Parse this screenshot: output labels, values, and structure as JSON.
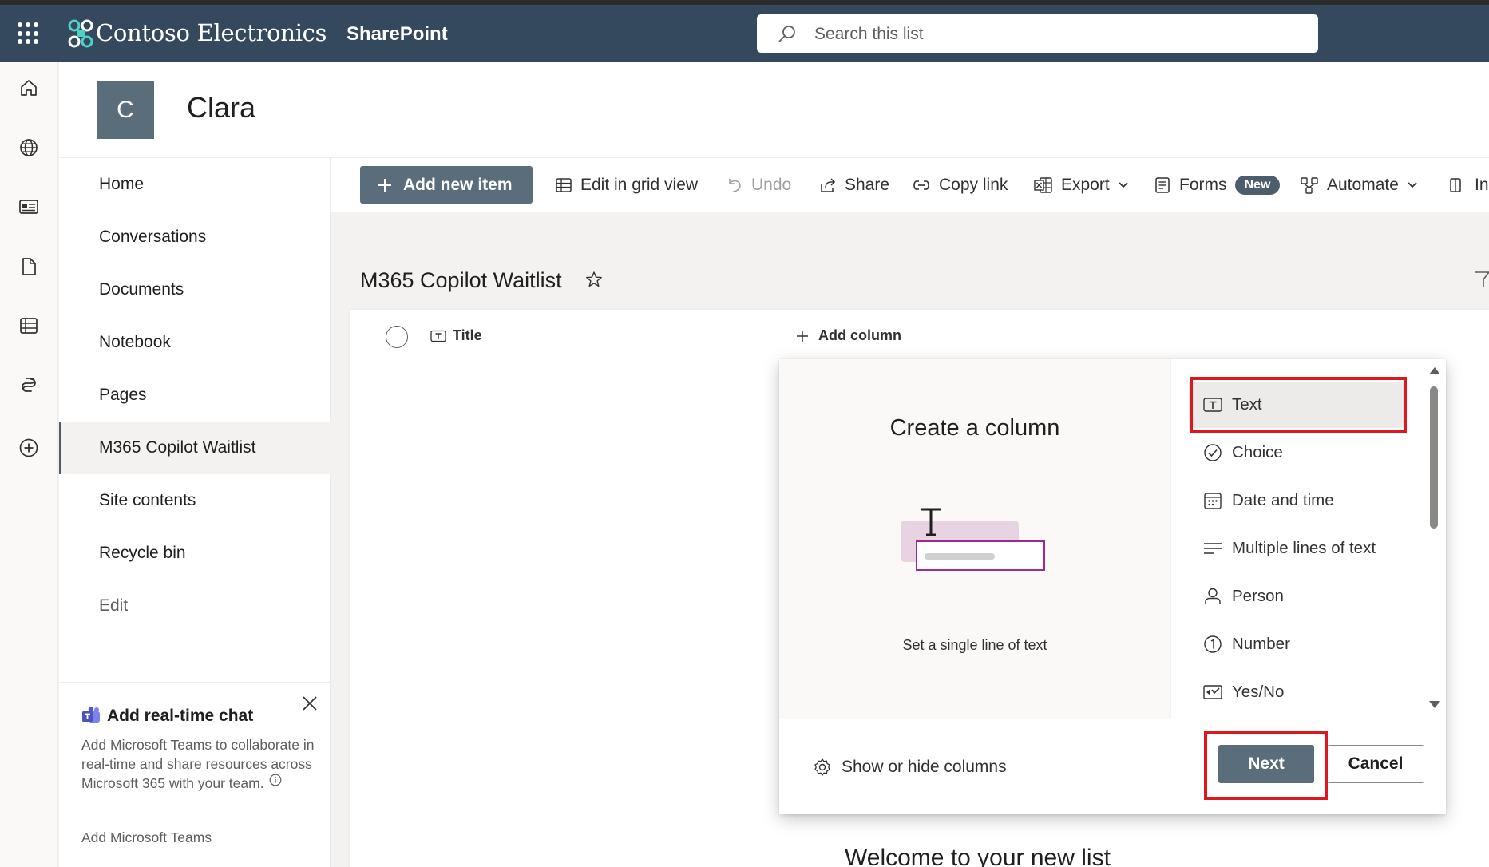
{
  "suite": {
    "brand": "Contoso Electronics",
    "app_name": "SharePoint",
    "search_placeholder": "Search this list"
  },
  "site": {
    "logo_letter": "C",
    "title": "Clara"
  },
  "nav": {
    "items": [
      {
        "label": "Home"
      },
      {
        "label": "Conversations"
      },
      {
        "label": "Documents"
      },
      {
        "label": "Notebook"
      },
      {
        "label": "Pages"
      },
      {
        "label": "M365 Copilot Waitlist",
        "selected": true
      },
      {
        "label": "Site contents"
      },
      {
        "label": "Recycle bin"
      },
      {
        "label": "Edit"
      }
    ]
  },
  "teams_card": {
    "title": "Add real-time chat",
    "body": "Add Microsoft Teams to collaborate in real-time and share resources across Microsoft 365 with your team.",
    "link": "Add Microsoft Teams"
  },
  "commands": {
    "add_new_item": "Add new item",
    "edit_grid": "Edit in grid view",
    "undo": "Undo",
    "share": "Share",
    "copy_link": "Copy link",
    "export": "Export",
    "forms": "Forms",
    "forms_badge": "New",
    "automate": "Automate",
    "integrate": "In"
  },
  "list": {
    "title": "M365 Copilot Waitlist",
    "columns": {
      "title": "Title",
      "add_column": "Add column"
    },
    "welcome": "Welcome to your new list"
  },
  "create_column": {
    "title": "Create a column",
    "description": "Set a single line of text",
    "types": [
      {
        "label": "Text",
        "icon": "text-icon",
        "selected": true
      },
      {
        "label": "Choice",
        "icon": "choice-icon"
      },
      {
        "label": "Date and time",
        "icon": "calendar-icon"
      },
      {
        "label": "Multiple lines of text",
        "icon": "multiline-icon"
      },
      {
        "label": "Person",
        "icon": "person-icon"
      },
      {
        "label": "Number",
        "icon": "number-icon"
      },
      {
        "label": "Yes/No",
        "icon": "yes-no-icon"
      }
    ],
    "show_hide": "Show or hide columns",
    "next": "Next",
    "cancel": "Cancel"
  },
  "colors": {
    "suite_bar": "#34495e",
    "accent": "#5a6d7b",
    "highlight_red": "#e0161e",
    "illustration_pink": "#e8d3e3",
    "illustration_border": "#9b2b8c"
  }
}
